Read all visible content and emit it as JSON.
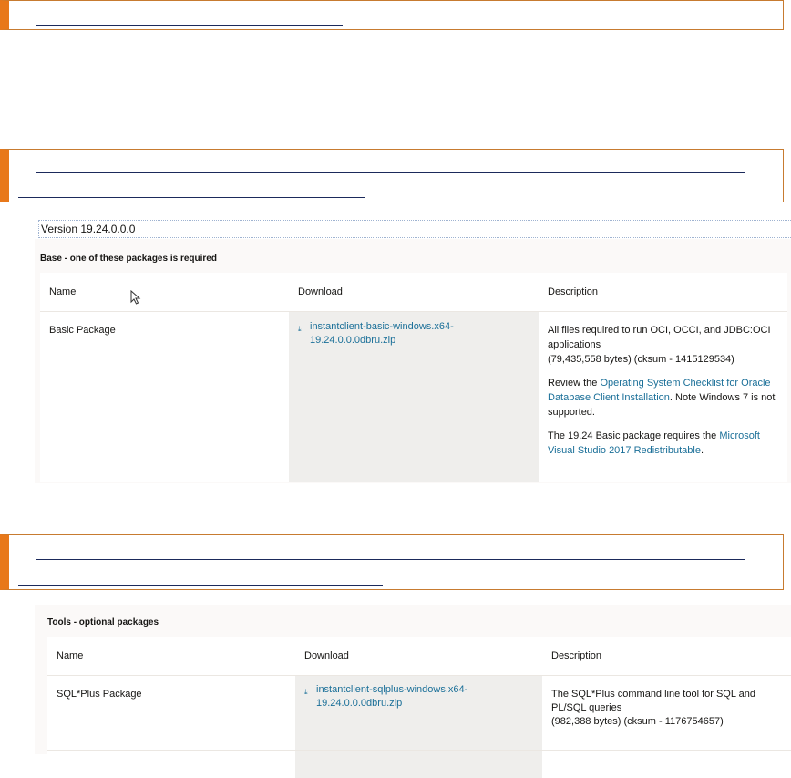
{
  "section1": {
    "version_label": "Version 19.24.0.0.0",
    "title": "Base - one of these packages is required",
    "columns": [
      "Name",
      "Download",
      "Description"
    ],
    "row": {
      "name": "Basic Package",
      "download_file": "instantclient-basic-windows.x64-19.24.0.0.0dbru.zip",
      "desc_p1_line1": "All files required to run OCI, OCCI, and JDBC:OCI applications",
      "desc_p1_line2": "(79,435,558 bytes) (cksum - 1415129534)",
      "desc_p2_prefix": "Review the ",
      "desc_p2_link": "Operating System Checklist for Oracle Database Client Installation",
      "desc_p2_suffix": ". Note Windows 7 is not supported.",
      "desc_p3_prefix": "The 19.24 Basic package requires the ",
      "desc_p3_link": "Microsoft Visual Studio 2017 Redistributable",
      "desc_p3_suffix": "."
    }
  },
  "section2": {
    "title": "Tools - optional packages",
    "columns": [
      "Name",
      "Download",
      "Description"
    ],
    "row": {
      "name": "SQL*Plus Package",
      "download_file": "instantclient-sqlplus-windows.x64-19.24.0.0.0dbru.zip",
      "desc_line1": "The SQL*Plus command line tool for SQL and PL/SQL queries",
      "desc_line2": "(982,388 bytes) (cksum - 1176754657)"
    }
  },
  "icons": {
    "download": "download-icon",
    "cursor": "mouse-pointer-icon"
  },
  "colors": {
    "accent_orange": "#e8781a",
    "link_blue": "#1a6f98",
    "download_cell_bg": "#efeeec"
  }
}
